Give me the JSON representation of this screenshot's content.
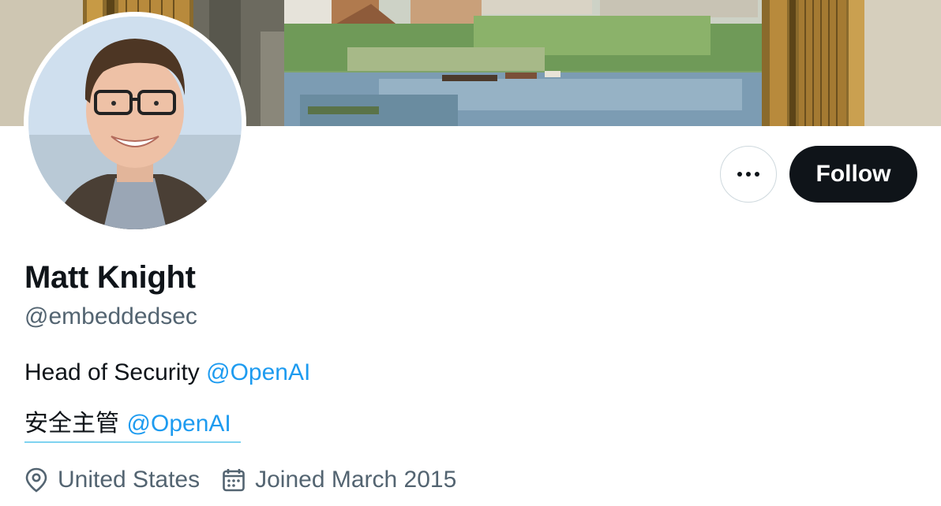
{
  "profile": {
    "display_name": "Matt Knight",
    "handle": "@embeddedsec",
    "bio": {
      "line1_text": "Head of Security ",
      "line1_mention": "@OpenAI",
      "line2_text": "安全主管 ",
      "line2_mention": "@OpenAI"
    },
    "location": "United States",
    "joined": "Joined March 2015"
  },
  "actions": {
    "more_icon": "more-horizontal-icon",
    "follow_label": "Follow"
  },
  "icons": {
    "location": "location-pin-icon",
    "joined": "calendar-icon"
  },
  "colors": {
    "text_primary": "#0f1419",
    "text_secondary": "#536471",
    "link": "#1d9bf0",
    "follow_bg": "#0f1419",
    "follow_text": "#ffffff",
    "border": "#cfd9de"
  }
}
